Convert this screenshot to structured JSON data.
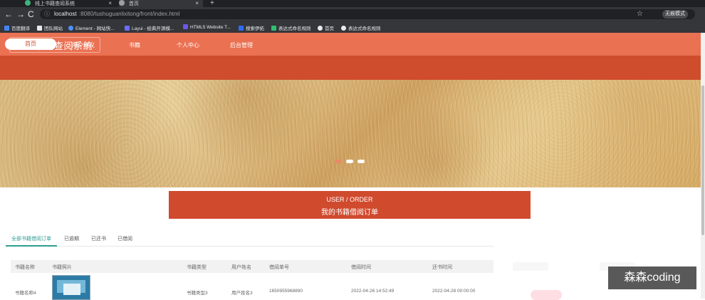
{
  "browser": {
    "tabs": [
      {
        "label": "线上书籍查阅系统",
        "active": false
      },
      {
        "label": "首页",
        "active": true
      }
    ],
    "new_tab": "+",
    "back": "←",
    "forward": "→",
    "reload": "C",
    "url_host": "localhost",
    "url_path": ":8080/tushuguanlixitong/front/index.html",
    "bookmark_star": "☆",
    "profile_label": "无痕模式",
    "bookmarks": [
      "百度翻译",
      "团队网站",
      "Element - 网站快...",
      "Layui - 经典开源模...",
      "HTML5 Website T...",
      "搜索伊拓",
      "表达式命名规则",
      "首页",
      "表达式命名规则"
    ]
  },
  "site": {
    "title": "线上书籍查阅系统",
    "nav": [
      "首页",
      "用户建议",
      "书籍",
      "个人中心",
      "后台管理"
    ],
    "order_banner": {
      "title": "USER / ORDER",
      "subtitle": "我的书籍借阅订单"
    },
    "tabs": [
      "全部书籍借阅订单",
      "已逾期",
      "已还书",
      "已借阅"
    ],
    "table": {
      "headers": [
        "书籍名称",
        "书籍照片",
        "书籍类型",
        "用户姓名",
        "借阅单号",
        "借阅时间",
        "还书时间"
      ],
      "rows": [
        {
          "book_name": "书籍名称4",
          "book_type": "书籍类型3",
          "user_name": "用户姓名3",
          "order_no": "1650955968890",
          "borrow_time": "2022-04-26 14:52:49",
          "return_time": "2022-04-28 00:00:00"
        }
      ]
    },
    "watermark": "森森coding"
  },
  "colors": {
    "primary": "#d04a2e",
    "header": "#ea7152",
    "accent": "#2f9d91"
  }
}
